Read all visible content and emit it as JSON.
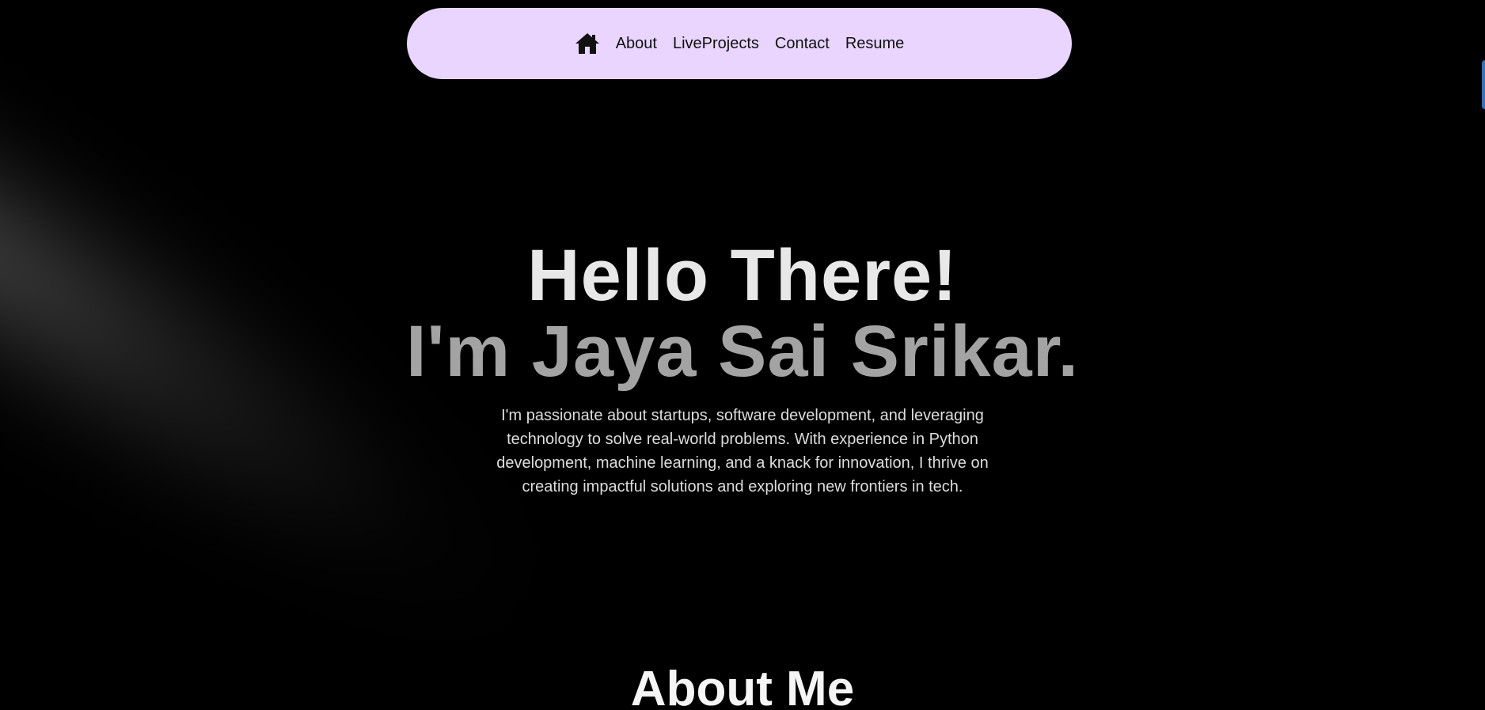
{
  "nav": {
    "home_icon": "home-icon",
    "items": [
      {
        "label": "About"
      },
      {
        "label": "LiveProjects"
      },
      {
        "label": "Contact"
      },
      {
        "label": "Resume"
      }
    ],
    "background": "#e9d5ff"
  },
  "hero": {
    "line1": "Hello There!",
    "line2": "I'm Jaya Sai Srikar.",
    "description": "I'm passionate about startups, software development, and leveraging technology to solve real-world problems. With experience in Python development, machine learning, and a knack for innovation, I thrive on creating impactful solutions and exploring new frontiers in tech."
  },
  "about": {
    "title": "About Me"
  },
  "colors": {
    "background": "#000000",
    "nav_bg": "#e9d5ff",
    "heading_light": "#e8e8e8",
    "heading_muted": "#a3a3a3"
  }
}
